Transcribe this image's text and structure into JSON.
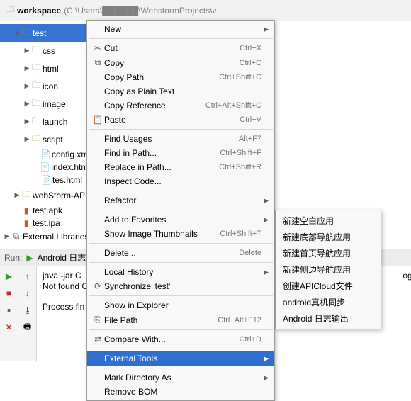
{
  "breadcrumb": {
    "title": "workspace",
    "path": "(C:\\Users\\██████\\WebstormProjects\\v"
  },
  "tree": {
    "items": [
      {
        "label": "test",
        "icon": "folder",
        "ind": 1,
        "tw": "▼",
        "sel": true
      },
      {
        "label": "css",
        "icon": "folder",
        "ind": 2,
        "tw": "▶"
      },
      {
        "label": "html",
        "icon": "folder",
        "ind": 2,
        "tw": "▶"
      },
      {
        "label": "icon",
        "icon": "folder",
        "ind": 2,
        "tw": "▶"
      },
      {
        "label": "image",
        "icon": "folder",
        "ind": 2,
        "tw": "▶"
      },
      {
        "label": "launch",
        "icon": "folder",
        "ind": 2,
        "tw": "▶"
      },
      {
        "label": "script",
        "icon": "folder",
        "ind": 2,
        "tw": "▶"
      },
      {
        "label": "config.xml",
        "icon": "file-xml",
        "ind": 3,
        "tw": ""
      },
      {
        "label": "index.html",
        "icon": "file-html",
        "ind": 3,
        "tw": ""
      },
      {
        "label": "tes.html",
        "icon": "file-html",
        "ind": 3,
        "tw": ""
      },
      {
        "label": "webStorm-AP",
        "icon": "folder",
        "ind": 1,
        "tw": "▶"
      },
      {
        "label": "test.apk",
        "icon": "file-apk",
        "ind": 1,
        "tw": ""
      },
      {
        "label": "test.ipa",
        "icon": "file-apk",
        "ind": 1,
        "tw": ""
      },
      {
        "label": "External Libraries",
        "icon": "file-lib",
        "ind": 0,
        "tw": "▶"
      }
    ]
  },
  "menu": {
    "items": [
      {
        "type": "item",
        "label": "New",
        "shortcut": "",
        "arrow": true
      },
      {
        "type": "sep"
      },
      {
        "type": "item",
        "label": "Cut",
        "shortcut": "Ctrl+X",
        "icon": "✂"
      },
      {
        "type": "item",
        "label": "Copy",
        "shortcut": "Ctrl+C",
        "icon": "⧉",
        "underline": true
      },
      {
        "type": "item",
        "label": "Copy Path",
        "shortcut": "Ctrl+Shift+C"
      },
      {
        "type": "item",
        "label": "Copy as Plain Text",
        "shortcut": ""
      },
      {
        "type": "item",
        "label": "Copy Reference",
        "shortcut": "Ctrl+Alt+Shift+C"
      },
      {
        "type": "item",
        "label": "Paste",
        "shortcut": "Ctrl+V",
        "icon": "📋"
      },
      {
        "type": "sep"
      },
      {
        "type": "item",
        "label": "Find Usages",
        "shortcut": "Alt+F7"
      },
      {
        "type": "item",
        "label": "Find in Path...",
        "shortcut": "Ctrl+Shift+F"
      },
      {
        "type": "item",
        "label": "Replace in Path...",
        "shortcut": "Ctrl+Shift+R"
      },
      {
        "type": "item",
        "label": "Inspect Code...",
        "shortcut": ""
      },
      {
        "type": "sep"
      },
      {
        "type": "item",
        "label": "Refactor",
        "shortcut": "",
        "arrow": true
      },
      {
        "type": "sep"
      },
      {
        "type": "item",
        "label": "Add to Favorites",
        "shortcut": "",
        "arrow": true
      },
      {
        "type": "item",
        "label": "Show Image Thumbnails",
        "shortcut": "Ctrl+Shift+T"
      },
      {
        "type": "sep"
      },
      {
        "type": "item",
        "label": "Delete...",
        "shortcut": "Delete"
      },
      {
        "type": "sep"
      },
      {
        "type": "item",
        "label": "Local History",
        "shortcut": "",
        "arrow": true
      },
      {
        "type": "item",
        "label": "Synchronize 'test'",
        "shortcut": "",
        "icon": "⟳"
      },
      {
        "type": "sep"
      },
      {
        "type": "item",
        "label": "Show in Explorer",
        "shortcut": ""
      },
      {
        "type": "item",
        "label": "File Path",
        "shortcut": "Ctrl+Alt+F12",
        "icon": "⎘"
      },
      {
        "type": "sep"
      },
      {
        "type": "item",
        "label": "Compare With...",
        "shortcut": "Ctrl+D",
        "icon": "⇄"
      },
      {
        "type": "sep"
      },
      {
        "type": "item",
        "label": "External Tools",
        "shortcut": "",
        "arrow": true,
        "hl": true
      },
      {
        "type": "sep"
      },
      {
        "type": "item",
        "label": "Mark Directory As",
        "shortcut": "",
        "arrow": true
      },
      {
        "type": "item",
        "label": "Remove BOM",
        "shortcut": ""
      }
    ]
  },
  "submenu": {
    "items": [
      "新建空白应用",
      "新建底部导航应用",
      "新建首页导航应用",
      "新建侧边导航应用",
      "创建APICloud文件",
      "android真机同步",
      "Android 日志输出"
    ]
  },
  "run": {
    "tab_label": "Run:",
    "config_name": "Android 日志输出",
    "line1": "java -jar C",
    "line2": "Not found C",
    "line3": "Process fin",
    "line1_tail": "og.jar C:\\User:"
  }
}
